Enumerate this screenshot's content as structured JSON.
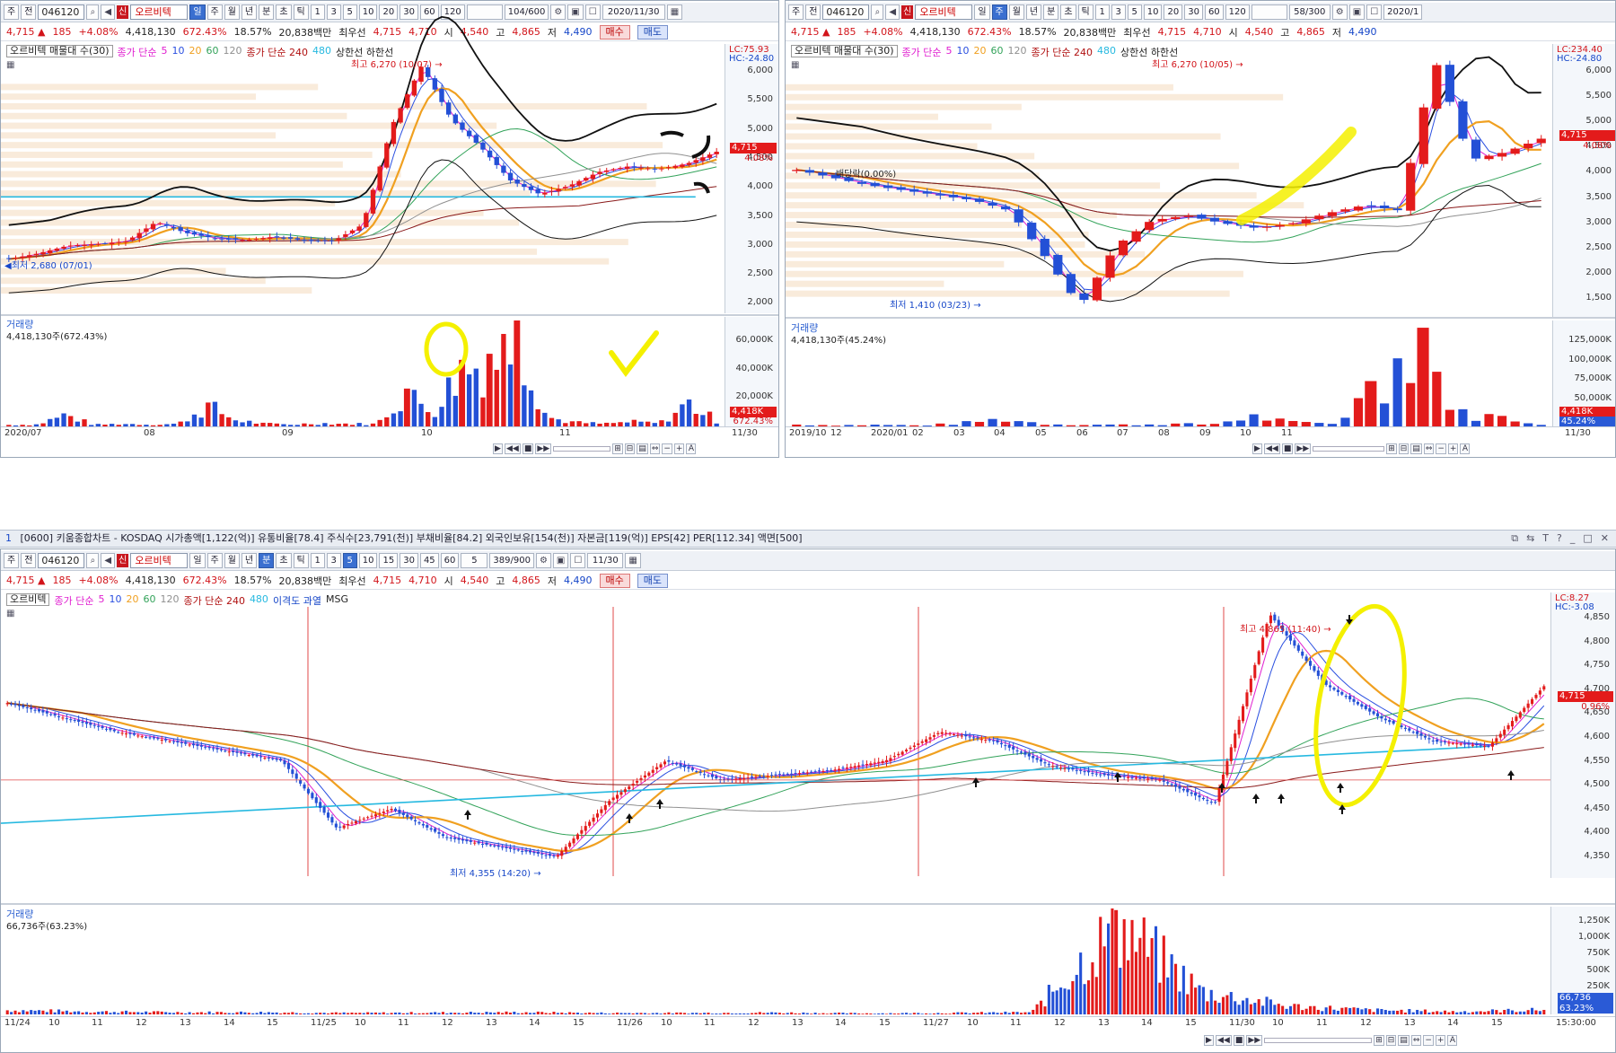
{
  "stock": {
    "code": "046120",
    "name": "오르비텍",
    "shin": "신",
    "price": "4,715",
    "arrow": "▲",
    "change": "185",
    "change_pct": "+4.08%",
    "volume": "4,418,130",
    "vol_ratio": "672.43%",
    "turnover": "18.57%",
    "amount": "20,838백만",
    "best_label": "최우선",
    "ask": "4,715",
    "bid": "4,710",
    "open_label": "시",
    "open": "4,540",
    "high_label": "고",
    "high": "4,865",
    "low_label": "저",
    "low": "4,490",
    "buy": "매수",
    "sell": "매도"
  },
  "toolbar_common": {
    "stock_type": "주",
    "prev": "전",
    "d": "일",
    "w": "주",
    "m": "월",
    "y": "년",
    "min": "분",
    "sec": "초",
    "tick": "틱",
    "legend_name": "오르비텍",
    "legend_suffix": "매물대 수(30)",
    "ma_label": "종가 단순",
    "ma_short": [
      "5",
      "10",
      "20",
      "60",
      "120"
    ],
    "ma_long_label": "종가 단순 240",
    "ma_480": "480",
    "limit_label": "상한선 하한선"
  },
  "daily": {
    "nums": [
      "1",
      "3",
      "5",
      "10",
      "20",
      "30",
      "60",
      "120"
    ],
    "count": "104/600",
    "date": "2020/11/30",
    "lc": "LC:75.93",
    "hc": "HC:-24.80",
    "y_ticks": [
      "6,000",
      "5,500",
      "5,000",
      "4,500",
      "4,000",
      "3,500",
      "3,000",
      "2,500",
      "2,000"
    ],
    "high_note": "최고 6,270 (10/07)",
    "low_note": "최저 2,680 (07/01)",
    "price_box": "4,715",
    "price_pct": "4.08%",
    "vol_title": "거래량",
    "vol_sub": "4,418,130주(672.43%)",
    "vol_ticks": [
      "60,000K",
      "40,000K",
      "20,000K"
    ],
    "vol_box": "4,418K",
    "vol_pct": "672.43%",
    "x_labels": [
      "2020/07",
      "08",
      "09",
      "10",
      "11"
    ],
    "x_last": "11/30"
  },
  "weekly": {
    "nums": [
      "1",
      "3",
      "5",
      "10",
      "20",
      "30",
      "60",
      "120"
    ],
    "count": "58/300",
    "date": "2020/1",
    "lc": "LC:234.40",
    "hc": "HC:-24.80",
    "y_ticks": [
      "6,000",
      "5,500",
      "5,000",
      "4,500",
      "4,000",
      "3,500",
      "3,000",
      "2,500",
      "2,000",
      "1,500"
    ],
    "high_note": "최고 6,270 (10/05)",
    "low_note": "최저 1,410 (03/23)",
    "dividend_note": "배당락(0.00%)",
    "price_box": "4,715",
    "price_pct": "4.08%",
    "vol_title": "거래량",
    "vol_sub": "4,418,130주(45.24%)",
    "vol_ticks": [
      "125,000K",
      "100,000K",
      "75,000K",
      "50,000K",
      "25,000K"
    ],
    "vol_box": "4,418K",
    "vol_pct": "45.24%",
    "x_labels": [
      "2019/10",
      "12",
      "2020/01",
      "02",
      "03",
      "04",
      "05",
      "06",
      "07",
      "08",
      "09",
      "10",
      "11"
    ],
    "x_last": "11/30"
  },
  "minute": {
    "strip": "[0600] 키움종합차트 - KOSDAQ 시가총액[1,122(억)] 유통비율[78.4] 주식수[23,791(천)] 부채비율[84.2] 외국인보유[154(천)] 자본금[119(억)] EPS[42] PER[112.34] 액면[500]",
    "strip_num": "1",
    "nums": [
      "1",
      "3",
      "5",
      "10",
      "15",
      "30",
      "45",
      "60"
    ],
    "interval": "5",
    "count": "389/900",
    "date": "11/30",
    "lc": "LC:8.27",
    "hc": "HC:-3.08",
    "legend_extra": "이격도 과열",
    "legend_msg": "MSG",
    "y_ticks": [
      "4,850",
      "4,800",
      "4,750",
      "4,700",
      "4,650",
      "4,600",
      "4,550",
      "4,500",
      "4,450",
      "4,400",
      "4,350"
    ],
    "high_note": "최고 4,865 (11:40)",
    "low_note": "최저 4,355 (14:20)",
    "price_box": "4,715",
    "price_pct": "0.96%",
    "vol_title": "거래량",
    "vol_sub": "66,736주(63.23%)",
    "vol_ticks": [
      "1,250K",
      "1,000K",
      "750K",
      "500K",
      "250K"
    ],
    "vol_box": "66,736",
    "vol_pct": "63.23%",
    "x_labels": [
      "11/24",
      "10",
      "11",
      "12",
      "13",
      "14",
      "15",
      "11/25",
      "10",
      "11",
      "12",
      "13",
      "14",
      "15",
      "11/26",
      "10",
      "11",
      "12",
      "13",
      "14",
      "15",
      "11/27",
      "10",
      "11",
      "12",
      "13",
      "14",
      "15",
      "11/30",
      "10",
      "11",
      "12",
      "13",
      "14",
      "15"
    ],
    "x_last": "15:30:00"
  },
  "colors": {
    "up": "#e31b1b",
    "down": "#2350d6",
    "ma5": "#e01fd0",
    "ma10": "#2a4fe0",
    "ma20": "#f0a020",
    "ma60": "#33a35a",
    "ma120": "#909090",
    "ma240": "#8a1a1a",
    "cyan": "#26b9e0",
    "bb": "#111111",
    "highlight": "#f4f000"
  },
  "chart_data": [
    {
      "type": "candlestick",
      "title": "오르비텍 daily",
      "x": [
        "2020/07",
        "08",
        "09",
        "10",
        "11",
        "11/30"
      ],
      "ylim": [
        1800,
        6400
      ],
      "series": [
        {
          "name": "price_path",
          "values": [
            2780,
            2880,
            3020,
            3050,
            3100,
            3450,
            3250,
            3150,
            3120,
            3180,
            3120,
            3100,
            3400,
            5200,
            6270,
            5300,
            4800,
            4200,
            3950,
            4100,
            4350,
            4450,
            4400,
            4500,
            4715
          ]
        }
      ],
      "high": 6270,
      "low": 2680,
      "last": 4715
    },
    {
      "type": "bar",
      "title": "거래량 daily",
      "ylim": [
        0,
        70000
      ],
      "series": [
        {
          "name": "volume_k",
          "values": [
            1200,
            1500,
            9000,
            1200,
            2000,
            1500,
            2000,
            16000,
            5000,
            2000,
            1500,
            2500,
            2000,
            1800,
            25000,
            12000,
            44000,
            48000,
            70000,
            7000,
            3000,
            2000,
            3500,
            2500,
            18000,
            4418
          ]
        }
      ]
    },
    {
      "type": "candlestick",
      "title": "오르비텍 weekly",
      "x": [
        "2019/10",
        "12",
        "2020/01",
        "02",
        "03",
        "04",
        "05",
        "06",
        "07",
        "08",
        "09",
        "10",
        "11",
        "11/30"
      ],
      "ylim": [
        1200,
        6300
      ],
      "series": [
        {
          "name": "price_path",
          "values": [
            4100,
            3950,
            3800,
            3700,
            3600,
            3500,
            3300,
            2400,
            1410,
            2600,
            3100,
            3200,
            3050,
            2950,
            3050,
            3250,
            3400,
            3300,
            6270,
            4300,
            4450,
            4715
          ]
        }
      ],
      "high": 6270,
      "low": 1410,
      "last": 4715
    },
    {
      "type": "bar",
      "title": "거래량 weekly",
      "ylim": [
        0,
        140000
      ],
      "series": [
        {
          "name": "volume_k",
          "values": [
            3000,
            2000,
            2500,
            1500,
            5000,
            12000,
            4000,
            3000,
            2500,
            4000,
            3000,
            16000,
            6000,
            5000,
            62000,
            135000,
            20000,
            15000,
            4418
          ]
        }
      ]
    },
    {
      "type": "candlestick",
      "title": "오르비텍 5분",
      "x": [
        "11/24",
        "11/25",
        "11/26",
        "11/27",
        "11/30",
        "15:30:00"
      ],
      "ylim": [
        4320,
        4880
      ],
      "series": [
        {
          "name": "price_path",
          "values": [
            4680,
            4650,
            4620,
            4600,
            4580,
            4560,
            4420,
            4460,
            4400,
            4380,
            4360,
            4480,
            4560,
            4520,
            4530,
            4540,
            4560,
            4620,
            4600,
            4550,
            4530,
            4520,
            4470,
            4865,
            4720,
            4650,
            4600,
            4590,
            4715
          ]
        }
      ],
      "high": 4865,
      "low": 4355,
      "last": 4715
    },
    {
      "type": "bar",
      "title": "거래량 5분",
      "ylim": [
        0,
        1300000
      ],
      "series": [
        {
          "name": "volume",
          "values": [
            60000,
            40000,
            30000,
            30000,
            20000,
            25000,
            30000,
            20000,
            20000,
            25000,
            15000,
            20000,
            30000,
            1280000,
            320000,
            120000,
            60000,
            40000,
            66736
          ]
        }
      ]
    }
  ]
}
